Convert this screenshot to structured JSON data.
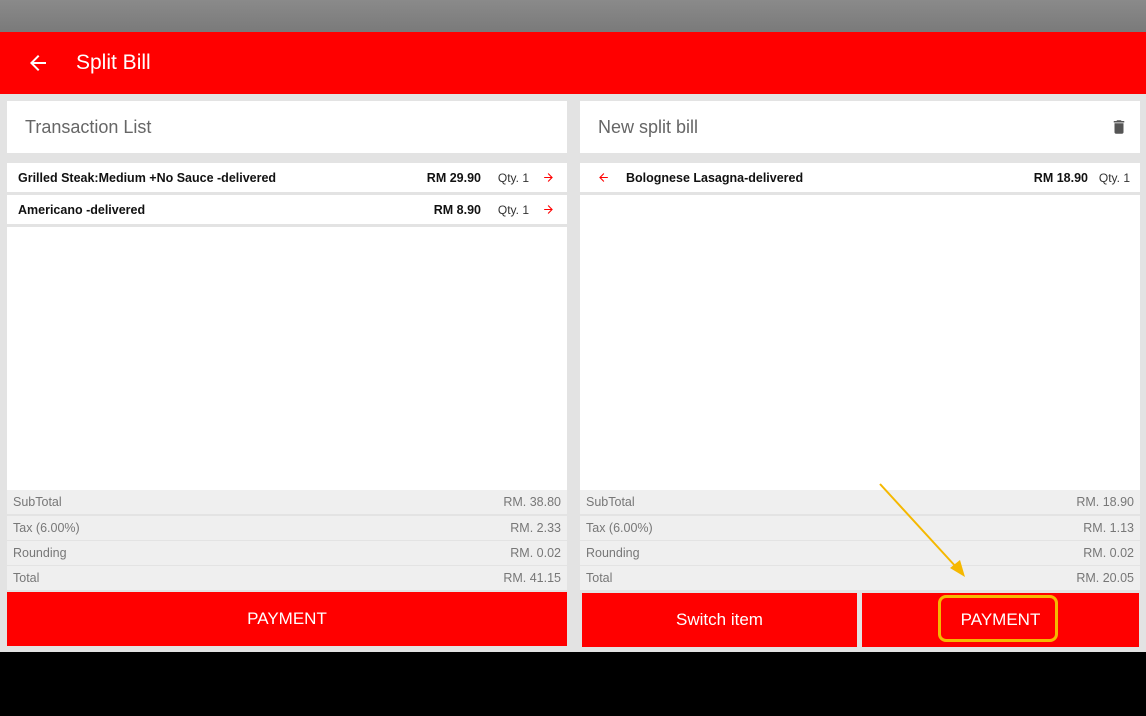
{
  "app": {
    "title": "Split Bill",
    "back_icon": "arrow-left-icon"
  },
  "left": {
    "header": "Transaction List",
    "items": [
      {
        "name": "Grilled Steak:Medium  +No Sauce -delivered",
        "price": "RM 29.90",
        "qty": "Qty. 1"
      },
      {
        "name": "Americano  -delivered",
        "price": "RM 8.90",
        "qty": "Qty. 1"
      }
    ],
    "summary": {
      "subtotal_label": "SubTotal",
      "subtotal": "RM. 38.80",
      "tax_label": "Tax (6.00%)",
      "tax": "RM. 2.33",
      "rounding_label": "Rounding",
      "rounding": "RM. 0.02",
      "total_label": "Total",
      "total": "RM. 41.15"
    },
    "payment_label": "PAYMENT"
  },
  "right": {
    "header": "New split bill",
    "items": [
      {
        "name": "Bolognese Lasagna-delivered",
        "price": "RM 18.90",
        "qty": "Qty. 1"
      }
    ],
    "summary": {
      "subtotal_label": "SubTotal",
      "subtotal": "RM. 18.90",
      "tax_label": "Tax (6.00%)",
      "tax": "RM. 1.13",
      "rounding_label": "Rounding",
      "rounding": "RM. 0.02",
      "total_label": "Total",
      "total": "RM. 20.05"
    },
    "switch_label": "Switch item",
    "payment_label": "PAYMENT"
  },
  "colors": {
    "brand_red": "#ff0000",
    "highlight": "#f5b800"
  }
}
